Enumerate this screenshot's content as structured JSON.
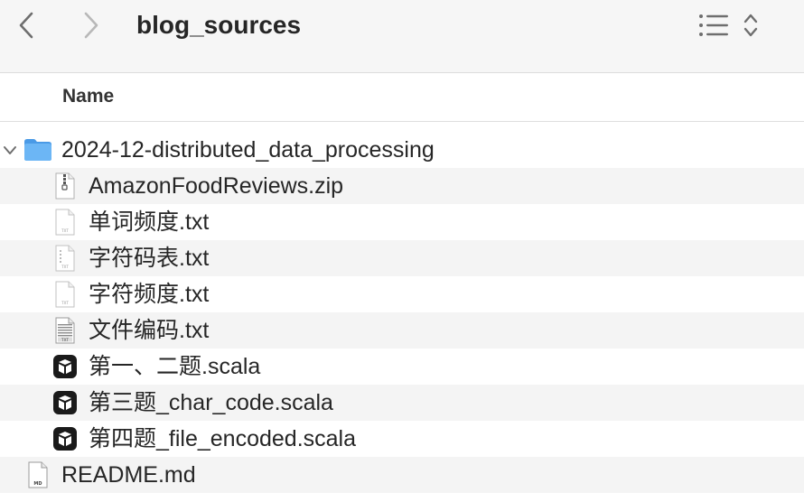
{
  "window": {
    "title": "blog_sources"
  },
  "toolbar": {
    "back_icon": "chevron-left-icon",
    "forward_icon": "chevron-right-icon",
    "view_icon": "list-view-icon",
    "sort_icon": "up-down-chevron-icon"
  },
  "columns": {
    "name": "Name"
  },
  "files": {
    "folder": {
      "name": "2024-12-distributed_data_processing",
      "icon": "folder-icon",
      "expanded": true,
      "color": "#5aa9f0"
    },
    "children": [
      {
        "name": "AmazonFoodReviews.zip",
        "icon": "zip-file-icon"
      },
      {
        "name": "单词频度.txt",
        "icon": "text-file-icon"
      },
      {
        "name": "字符码表.txt",
        "icon": "text-file-icon"
      },
      {
        "name": "字符频度.txt",
        "icon": "text-file-icon"
      },
      {
        "name": "文件编码.txt",
        "icon": "text-file-icon"
      },
      {
        "name": "第一、二题.scala",
        "icon": "scala-file-icon"
      },
      {
        "name": "第三题_char_code.scala",
        "icon": "scala-file-icon"
      },
      {
        "name": "第四题_file_encoded.scala",
        "icon": "scala-file-icon"
      }
    ],
    "readme": {
      "name": "README.md",
      "icon": "markdown-file-icon",
      "badge": "MD"
    }
  },
  "colors": {
    "toolbar_bg": "#f6f6f6",
    "row_stripe": "#f4f4f4"
  }
}
